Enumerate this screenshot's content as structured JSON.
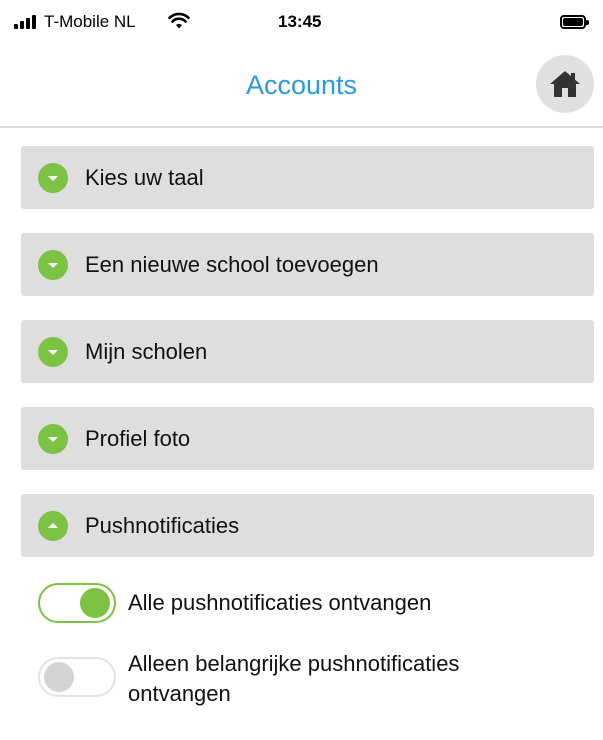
{
  "status_bar": {
    "carrier": "T-Mobile NL",
    "time": "13:45",
    "icons": [
      "signal-icon",
      "wifi-icon",
      "battery-icon"
    ]
  },
  "header": {
    "title": "Accounts",
    "home_icon": "home-icon"
  },
  "sections": [
    {
      "label": "Kies uw taal",
      "expanded": false
    },
    {
      "label": "Een nieuwe school toevoegen",
      "expanded": false
    },
    {
      "label": "Mijn scholen",
      "expanded": false
    },
    {
      "label": "Profiel foto",
      "expanded": false
    },
    {
      "label": "Pushnotificaties",
      "expanded": true
    }
  ],
  "push": {
    "options": [
      {
        "label": "Alle pushnotificaties ontvangen",
        "enabled": true
      },
      {
        "label": "Alleen belangrijke pushnotificaties ontvangen",
        "enabled": false
      }
    ]
  },
  "colors": {
    "accent_green": "#7cc243",
    "title_blue": "#2a9bd8",
    "section_bg": "#dedede"
  }
}
